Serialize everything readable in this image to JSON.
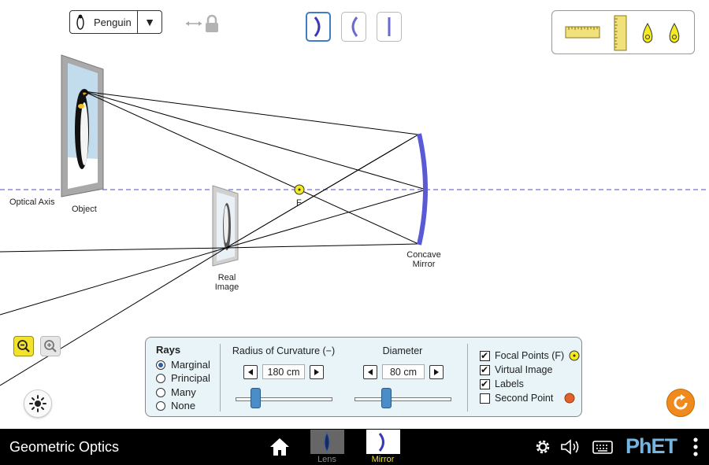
{
  "object_selector": {
    "selected": "Penguin"
  },
  "optic_types": [
    {
      "name": "concave-mirror",
      "selected": true
    },
    {
      "name": "convex-mirror",
      "selected": false
    },
    {
      "name": "flat-mirror",
      "selected": false
    }
  ],
  "toolbox": {
    "tools": [
      "ruler-horizontal-icon",
      "ruler-vertical-icon",
      "point-probe-icon",
      "point-probe-icon"
    ]
  },
  "scene": {
    "optical_axis_label": "Optical Axis",
    "object_label": "Object",
    "real_image_label_line1": "Real",
    "real_image_label_line2": "Image",
    "focal_point_label": "F",
    "mirror_label_line1": "Concave",
    "mirror_label_line2": "Mirror"
  },
  "control_panel": {
    "rays": {
      "title": "Rays",
      "options": [
        "Marginal",
        "Principal",
        "Many",
        "None"
      ],
      "selected": "Marginal"
    },
    "radius": {
      "title": "Radius of Curvature (−)",
      "value": "180 cm",
      "slider_fraction": 0.2
    },
    "diameter": {
      "title": "Diameter",
      "value": "80 cm",
      "slider_fraction": 0.33
    },
    "checkboxes": [
      {
        "label": "Focal Points (F)",
        "checked": true
      },
      {
        "label": "Virtual Image",
        "checked": true
      },
      {
        "label": "Labels",
        "checked": true
      },
      {
        "label": "Second Point",
        "checked": false
      }
    ]
  },
  "navbar": {
    "title": "Geometric Optics",
    "screens": [
      {
        "label": "Lens",
        "selected": false
      },
      {
        "label": "Mirror",
        "selected": true
      }
    ],
    "brand": "PhET"
  },
  "colors": {
    "optical_axis": "#8888dd",
    "mirror": "#5a5ad6",
    "focal_point": "#f3ea1f",
    "panel_bg": "#e8f4f8",
    "reset": "#f08a1c",
    "selected_screen_label": "#f2e22b",
    "second_point_marker": "#e0622a"
  }
}
